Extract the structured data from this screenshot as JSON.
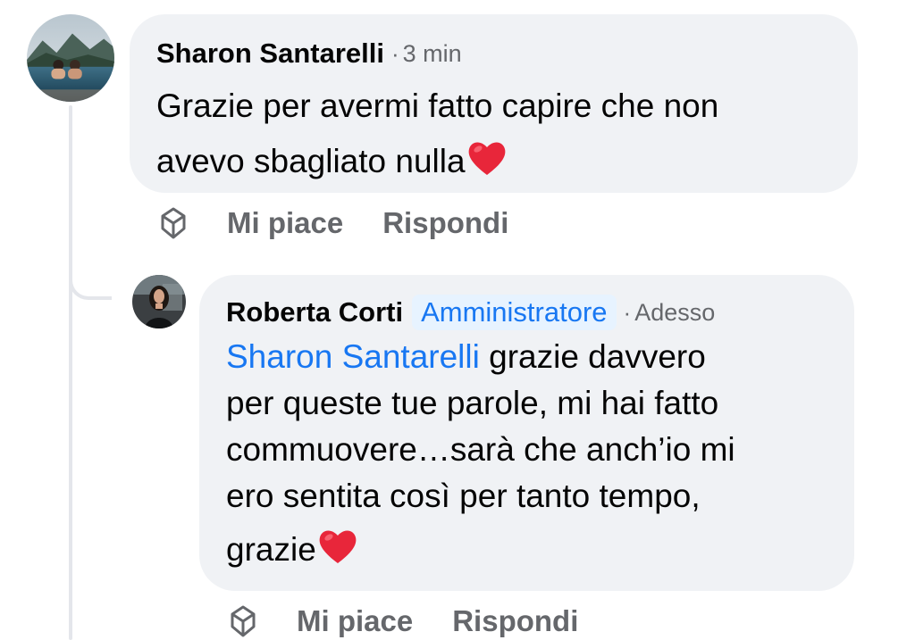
{
  "comments": [
    {
      "author": "Sharon Santarelli",
      "time": "3 min",
      "separator": "·",
      "text_line_1": "Grazie per avermi fatto capire che non",
      "text_line_2": "avevo sbagliato nulla",
      "emoji": "heart",
      "actions": {
        "like": "Mi piace",
        "reply": "Rispondi"
      }
    },
    {
      "author": "Roberta Corti",
      "badge": "Amministratore",
      "time": "Adesso",
      "separator": "·",
      "mention": "Sharon Santarelli",
      "text_line_1": " grazie davvero",
      "text_line_2": "per queste tue parole, mi hai fatto",
      "text_line_3": "commuovere…sarà che anch’io mi",
      "text_line_4": "ero sentita così per tanto tempo,",
      "text_line_5": "grazie",
      "emoji": "heart",
      "actions": {
        "like": "Mi piace",
        "reply": "Rispondi"
      }
    }
  ],
  "icons": {
    "reaction": "reaction-gem-icon",
    "heart": "red-heart-emoji"
  },
  "colors": {
    "bubble": "#f0f2f5",
    "link": "#1877f2",
    "badge_bg": "#e7f3ff",
    "muted": "#65676b",
    "heart": "#e8263a"
  }
}
